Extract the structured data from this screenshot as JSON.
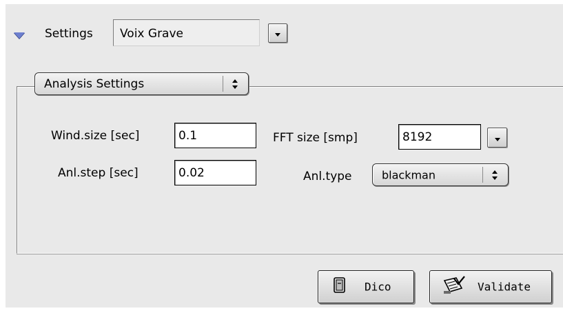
{
  "settings": {
    "label": "Settings",
    "preset_value": "Voix Grave"
  },
  "group": {
    "popup_label": "Analysis Settings"
  },
  "fields": {
    "wind_size_label": "Wind.size [sec]",
    "wind_size_value": "0.1",
    "anl_step_label": "Anl.step [sec]",
    "anl_step_value": "0.02",
    "fft_size_label": "FFT size [smp]",
    "fft_size_value": "8192",
    "anl_type_label": "Anl.type",
    "anl_type_value": "blackman"
  },
  "buttons": {
    "dico_label": "Dico",
    "validate_label": "Validate"
  },
  "colors": {
    "background": "#e9e9e9",
    "disclosure_accent": "#6d7fcf"
  },
  "icons": {
    "disclosure": "disclosure-triangle-expanded",
    "dico": "document-icon",
    "validate": "validate-check-icon"
  }
}
